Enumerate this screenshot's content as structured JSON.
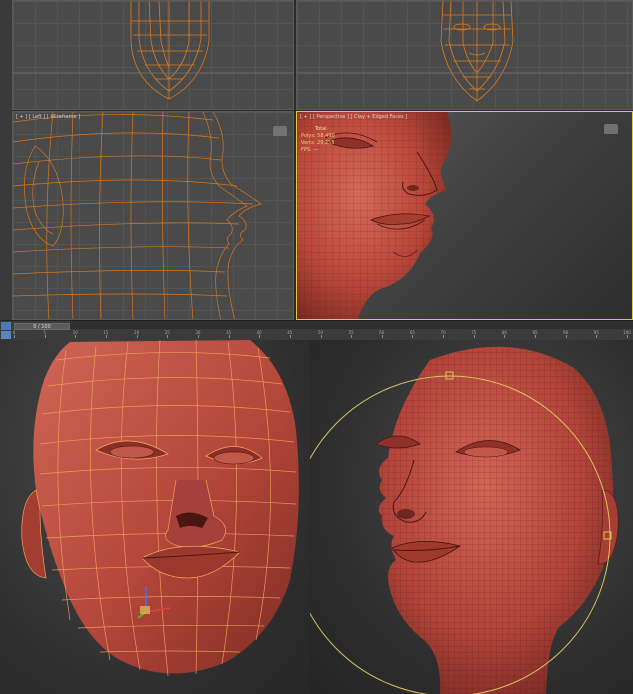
{
  "viewports": {
    "top_left": {
      "label": ""
    },
    "top_right": {
      "label": ""
    },
    "left": {
      "label": "[ + ] [ Left ] [ Wireframe ]"
    },
    "perspective": {
      "label": "[ + ] [ Perspective ] [ Clay + Edged Faces ]",
      "stats": {
        "header": "Total",
        "polys_label": "Polys:",
        "polys": "58,490",
        "verts_label": "Verts:",
        "verts": "29,255",
        "fps_label": "FPS:",
        "fps": "—"
      }
    }
  },
  "timeline": {
    "frame": "0 / 100",
    "ticks": [
      "0",
      "5",
      "10",
      "15",
      "20",
      "25",
      "30",
      "35",
      "40",
      "45",
      "50",
      "55",
      "60",
      "65",
      "70",
      "75",
      "80",
      "85",
      "90",
      "95",
      "100"
    ]
  },
  "colors": {
    "clay": "#b9473a",
    "wire_orange": "#e07a1a",
    "edge_dark": "#5a1c16",
    "active_border": "#e6c445"
  }
}
